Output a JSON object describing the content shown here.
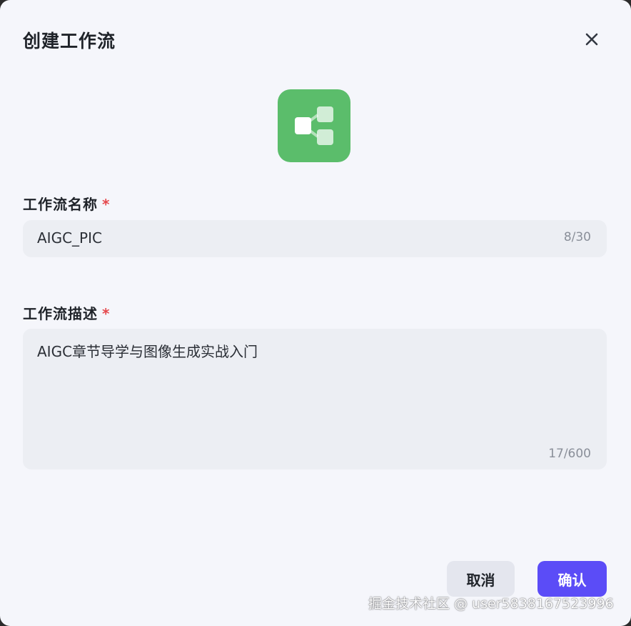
{
  "dialog": {
    "title": "创建工作流",
    "close_icon": "close-icon",
    "workflow_icon": {
      "name": "workflow-icon",
      "color": "#5bbd6b"
    }
  },
  "form": {
    "name": {
      "label": "工作流名称",
      "required_mark": "*",
      "value": "AIGC_PIC",
      "counter": "8/30"
    },
    "description": {
      "label": "工作流描述",
      "required_mark": "*",
      "value": "AIGC章节导学与图像生成实战入门",
      "counter": "17/600"
    }
  },
  "footer": {
    "cancel_label": "取消",
    "confirm_label": "确认"
  },
  "watermark": "掘金技术社区 @ user5838167523996",
  "colors": {
    "accent": "#5b4cf7",
    "required": "#e5484d",
    "background": "#f5f6fb"
  }
}
